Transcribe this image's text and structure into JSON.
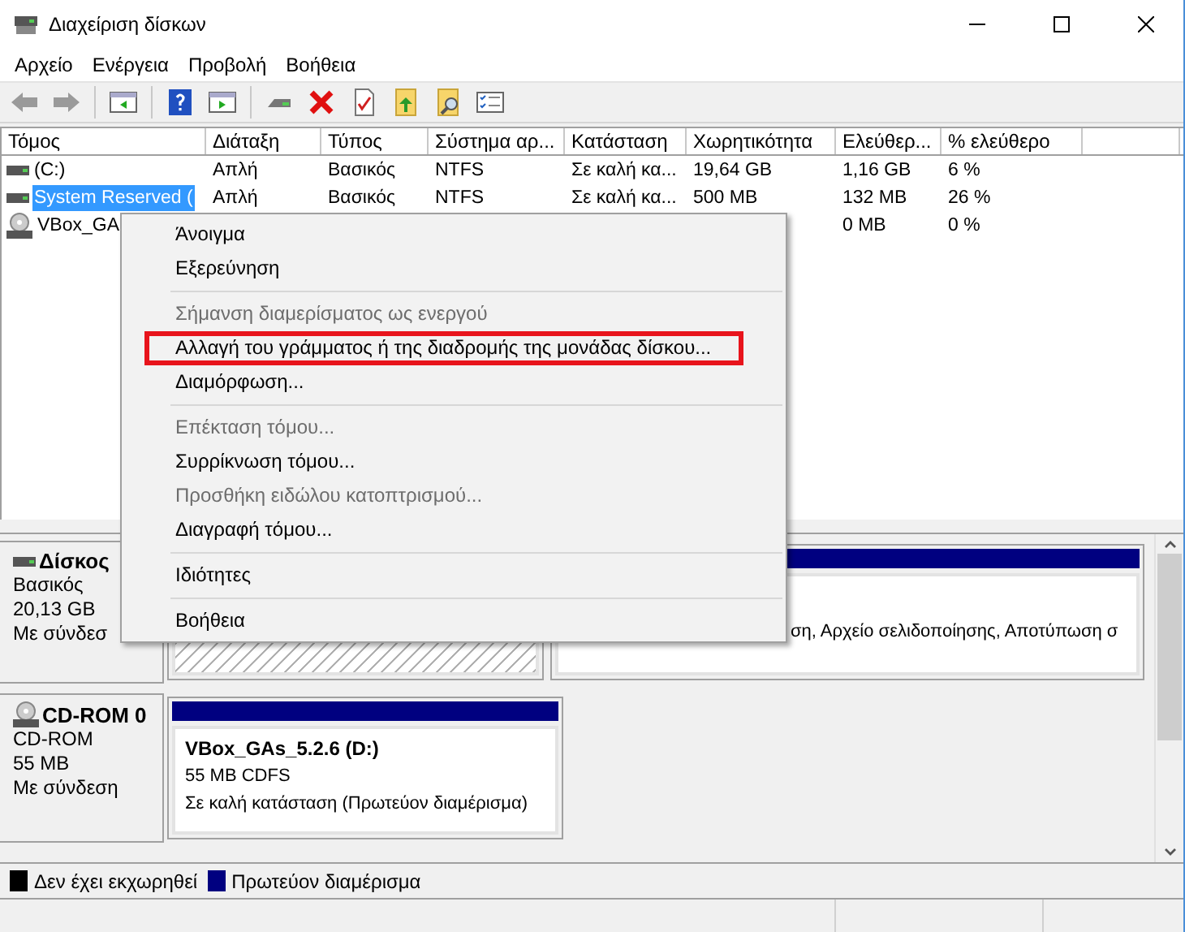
{
  "window": {
    "title": "Διαχείριση δίσκων"
  },
  "menu_bar": [
    "Αρχείο",
    "Ενέργεια",
    "Προβολή",
    "Βοήθεια"
  ],
  "volume_table": {
    "columns": [
      "Τόμος",
      "Διάταξη",
      "Τύπος",
      "Σύστημα αρ...",
      "Κατάσταση",
      "Χωρητικότητα",
      "Ελεύθερ...",
      "% ελεύθερο"
    ],
    "rows": [
      {
        "kind": "disk",
        "selected": false,
        "cells": {
          "volume": "(C:)",
          "layout": "Απλή",
          "type": "Βασικός",
          "fs": "NTFS",
          "status": "Σε καλή κα...",
          "capacity": "19,64 GB",
          "free": "1,16 GB",
          "free_pct": "6 %"
        }
      },
      {
        "kind": "disk",
        "selected": true,
        "cells": {
          "volume": "System Reserved (",
          "layout": "Απλή",
          "type": "Βασικός",
          "fs": "NTFS",
          "status": "Σε καλή κα...",
          "capacity": "500 MB",
          "free": "132 MB",
          "free_pct": "26 %"
        }
      },
      {
        "kind": "cdrom",
        "selected": false,
        "cells": {
          "volume": "VBox_GA",
          "free": "0 MB",
          "free_pct": "0 %"
        }
      }
    ]
  },
  "context_menu": {
    "items": [
      {
        "kind": "item",
        "label": "Άνοιγμα",
        "disabled": false,
        "highlighted": false
      },
      {
        "kind": "item",
        "label": "Εξερεύνηση",
        "disabled": false,
        "highlighted": false
      },
      {
        "kind": "separator"
      },
      {
        "kind": "item",
        "label": "Σήμανση διαμερίσματος ως ενεργού",
        "disabled": true,
        "highlighted": false
      },
      {
        "kind": "item",
        "label": "Αλλαγή  του γράμματος ή της διαδρομής της μονάδας δίσκου...",
        "disabled": false,
        "highlighted": true
      },
      {
        "kind": "item",
        "label": "Διαμόρφωση...",
        "disabled": false,
        "highlighted": false
      },
      {
        "kind": "separator"
      },
      {
        "kind": "item",
        "label": "Επέκταση τόμου...",
        "disabled": true,
        "highlighted": false
      },
      {
        "kind": "item",
        "label": "Συρρίκνωση τόμου...",
        "disabled": false,
        "highlighted": false
      },
      {
        "kind": "item",
        "label": "Προσθήκη ειδώλου κατοπτρισμού...",
        "disabled": true,
        "highlighted": false
      },
      {
        "kind": "item",
        "label": "Διαγραφή τόμου...",
        "disabled": false,
        "highlighted": false
      },
      {
        "kind": "separator"
      },
      {
        "kind": "item",
        "label": "Ιδιότητες",
        "disabled": false,
        "highlighted": false
      },
      {
        "kind": "separator"
      },
      {
        "kind": "item",
        "label": "Βοήθεια",
        "disabled": false,
        "highlighted": false
      }
    ]
  },
  "disks": [
    {
      "kind": "disk",
      "name": "Δίσκος",
      "lines": [
        "Βασικός",
        "20,13 GB",
        "Με σύνδεσ"
      ],
      "partitions": [
        {
          "kind": "hatched"
        },
        {
          "kind": "plain",
          "lines": [
            "ση, Αρχείο σελιδοποίησης, Αποτύπωση σ"
          ]
        }
      ]
    },
    {
      "kind": "cdrom",
      "name": "CD-ROM 0",
      "lines": [
        "CD-ROM",
        "55 MB",
        "Με σύνδεση"
      ],
      "partitions": [
        {
          "kind": "plain",
          "title": "VBox_GAs_5.2.6  (D:)",
          "lines": [
            "55 MB CDFS",
            "Σε καλή κατάσταση (Πρωτεύον διαμέρισμα)"
          ]
        }
      ]
    }
  ],
  "legend": [
    {
      "label": "Δεν έχει εκχωρηθεί",
      "color": "#000000"
    },
    {
      "label": "Πρωτεύον διαμέρισμα",
      "color": "#000080"
    }
  ]
}
